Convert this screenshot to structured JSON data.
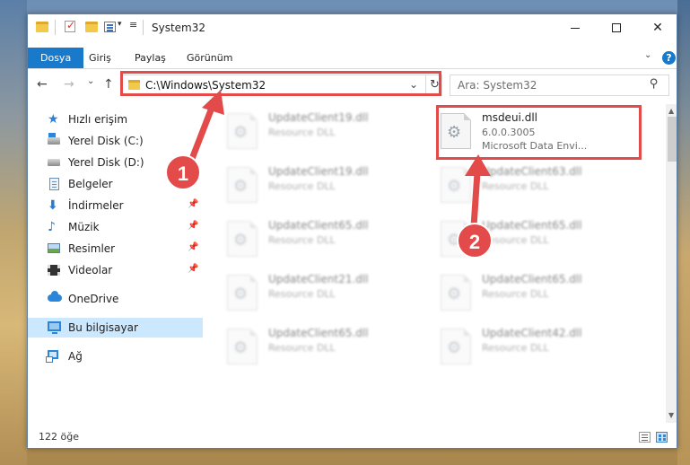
{
  "window": {
    "title": "System32",
    "controls": {
      "minimize": "—",
      "maximize": "",
      "close": "✕"
    }
  },
  "ribbon": {
    "tabs": [
      {
        "label": "Dosya"
      },
      {
        "label": "Giriş"
      },
      {
        "label": "Paylaş"
      },
      {
        "label": "Görünüm"
      }
    ],
    "collapse_glyph": "⌄",
    "help_glyph": "?"
  },
  "navbar": {
    "back": "←",
    "forward": "→",
    "recent": "⌄",
    "up": "↑",
    "address": "C:\\Windows\\System32",
    "address_drop": "⌄",
    "refresh": "↻",
    "search_placeholder": "Ara: System32",
    "search_glyph": "⚲"
  },
  "sidebar": {
    "items": [
      {
        "label": "Hızlı erişim",
        "icon": "star-icon"
      },
      {
        "label": "Yerel Disk (C:)",
        "icon": "drive-icon"
      },
      {
        "label": "Yerel Disk (D:)",
        "icon": "drive-icon"
      },
      {
        "label": "Belgeler",
        "icon": "documents-icon"
      },
      {
        "label": "İndirmeler",
        "icon": "downloads-icon"
      },
      {
        "label": "Müzik",
        "icon": "music-icon"
      },
      {
        "label": "Resimler",
        "icon": "pictures-icon"
      },
      {
        "label": "Videolar",
        "icon": "videos-icon"
      },
      {
        "label": "OneDrive",
        "icon": "onedrive-icon"
      },
      {
        "label": "Bu bilgisayar",
        "icon": "this-pc-icon"
      },
      {
        "label": "Ağ",
        "icon": "network-icon"
      }
    ],
    "pin_glyph": "📌",
    "glyphs": {
      "star": "★",
      "down": "⬇",
      "music": "♪"
    }
  },
  "files": {
    "left": [
      {
        "name": "UpdateClient19.dll",
        "type": "Resource DLL"
      },
      {
        "name": "UpdateClient19.dll",
        "type": "Resource DLL"
      },
      {
        "name": "UpdateClient65.dll",
        "type": "Resource DLL"
      },
      {
        "name": "UpdateClient21.dll",
        "type": "Resource DLL"
      },
      {
        "name": "UpdateClient65.dll",
        "type": "Resource DLL"
      }
    ],
    "right": [
      {
        "name": "msdeui.dll",
        "version": "6.0.0.3005",
        "type": "Microsoft Data Envi..."
      },
      {
        "name": "UpdateClient63.dll",
        "type": "Resource DLL"
      },
      {
        "name": "UpdateClient65.dll",
        "type": "Resource DLL"
      },
      {
        "name": "UpdateClient65.dll",
        "type": "Resource DLL"
      },
      {
        "name": "UpdateClient42.dll",
        "type": "Resource DLL"
      }
    ]
  },
  "status": {
    "item_count": "122 öğe"
  },
  "annotations": {
    "badge1": "1",
    "badge2": "2",
    "color": "#e34b4b"
  }
}
